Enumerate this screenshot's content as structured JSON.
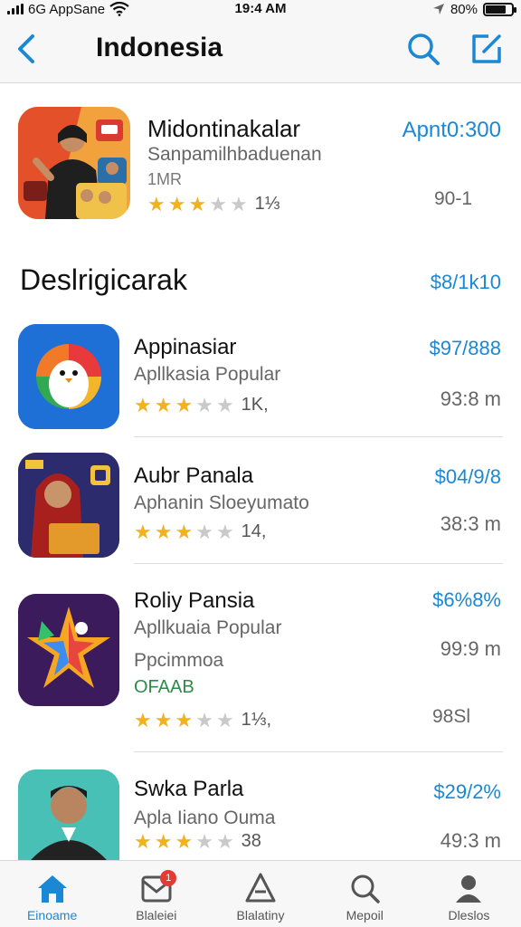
{
  "status_bar": {
    "carrier": "6G AppSane",
    "time": "19:4 AM",
    "battery": "80%",
    "battery_level": 0.8
  },
  "nav": {
    "title": "Indonesia",
    "back_icon": "chevron-left-icon",
    "search_icon": "search-icon",
    "compose_icon": "compose-icon"
  },
  "featured": {
    "name": "Midontinakalar",
    "subtitle": "Sanpamilhbaduenan",
    "subtitle2": "1MR",
    "rating_count": "1⅓",
    "rating": 3,
    "price": "Apnt0:300",
    "size": "90-1"
  },
  "section": {
    "title": "Deslrigicarak",
    "link": "$8/1k10"
  },
  "apps": [
    {
      "name": "Appinasiar",
      "subtitle": "Apllkasia Popular",
      "rating": 3,
      "rating_count": "1K,",
      "price": "$97/888",
      "size": "93:8 m"
    },
    {
      "name": "Aubr Panala",
      "subtitle": "Aphanin Sloeyumato",
      "rating": 3,
      "rating_count": "14,",
      "price": "$04/9/8",
      "size": "38:3 m"
    },
    {
      "name": "Roliy Pansia",
      "subtitle": "Apllkuaia Popular",
      "extra": "Ppcimmoa",
      "extra2": "OFAAB",
      "rating": 3,
      "rating_count": "1⅓,",
      "price": "$6%8%",
      "size": "99:9 m",
      "size2": "98Sl"
    },
    {
      "name": "Swka Parla",
      "subtitle": "Apla Iiano Ouma",
      "rating": 3,
      "rating_count": "38",
      "price": "$29/2%",
      "size": "49:3 m"
    }
  ],
  "tabs": [
    {
      "label": "Einoame",
      "icon": "home-icon",
      "active": true
    },
    {
      "label": "Blaleiei",
      "icon": "inbox-icon",
      "badge": "1"
    },
    {
      "label": "Blalatiny",
      "icon": "apps-icon"
    },
    {
      "label": "Mepoil",
      "icon": "search-icon"
    },
    {
      "label": "Dleslos",
      "icon": "profile-icon"
    }
  ],
  "colors": {
    "accent": "#1a88d4",
    "star": "#f0b21d",
    "badge": "#e53935"
  }
}
